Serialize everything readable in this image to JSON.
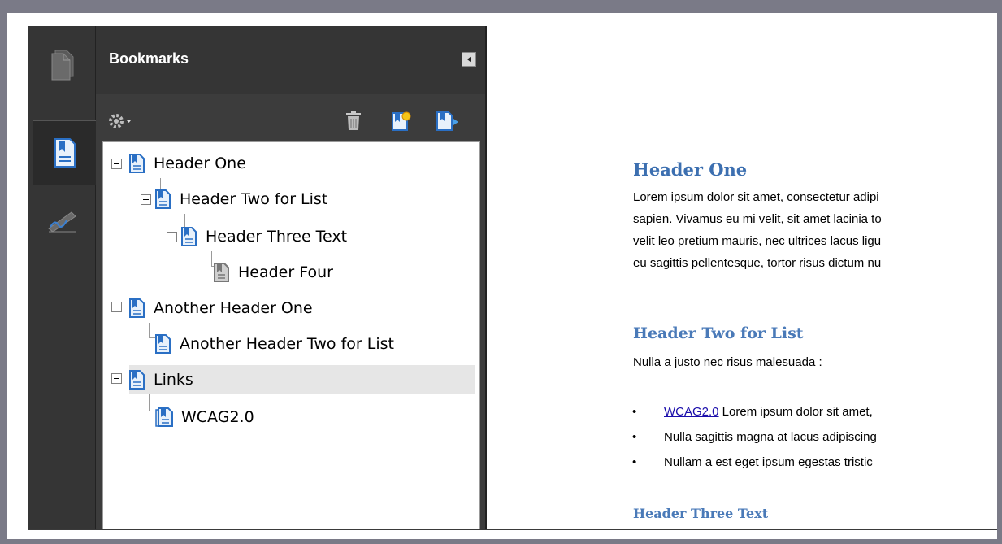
{
  "panel": {
    "title": "Bookmarks"
  },
  "icons": {
    "rail": [
      "pages-icon",
      "bookmarks-icon",
      "signature-icon"
    ],
    "toolbar": [
      "options-gear-icon",
      "delete-bookmark-icon",
      "new-bookmark-icon",
      "expand-bookmark-icon"
    ],
    "colors": {
      "bookmark_blue": "#2a6fc4",
      "bookmark_gray": "#8a8a8a",
      "panel_dark": "#3c3c3c"
    }
  },
  "bookmarks": [
    {
      "label": "Header One",
      "level": 0,
      "expanded": true
    },
    {
      "label": "Header Two for List",
      "level": 1,
      "expanded": true
    },
    {
      "label": "Header Three Text",
      "level": 2,
      "expanded": true
    },
    {
      "label": "Header Four",
      "level": 3
    },
    {
      "label": "Another Header One",
      "level": 0,
      "expanded": true
    },
    {
      "label": "Another Header Two for List",
      "level": 1
    },
    {
      "label": "Links",
      "level": 0,
      "expanded": true,
      "selected": true
    },
    {
      "label": "WCAG2.0",
      "level": 1
    }
  ],
  "document": {
    "h1": "Header One",
    "paragraph_lines": [
      "Lorem ipsum dolor sit amet, consectetur adipi",
      "sapien. Vivamus eu mi velit, sit amet lacinia to",
      "velit leo pretium mauris, nec ultrices lacus ligu",
      "eu sagittis pellentesque, tortor risus dictum nu"
    ],
    "h2": "Header Two for List",
    "list_intro": "Nulla a justo nec risus malesuada :",
    "list_items": [
      {
        "link": "WCAG2.0",
        "text": " Lorem ipsum dolor sit amet,"
      },
      {
        "link": "",
        "text": "Nulla sagittis magna at lacus adipiscing"
      },
      {
        "link": "",
        "text": "Nullam a est eget ipsum egestas tristic"
      }
    ],
    "h3": "Header Three Text"
  }
}
